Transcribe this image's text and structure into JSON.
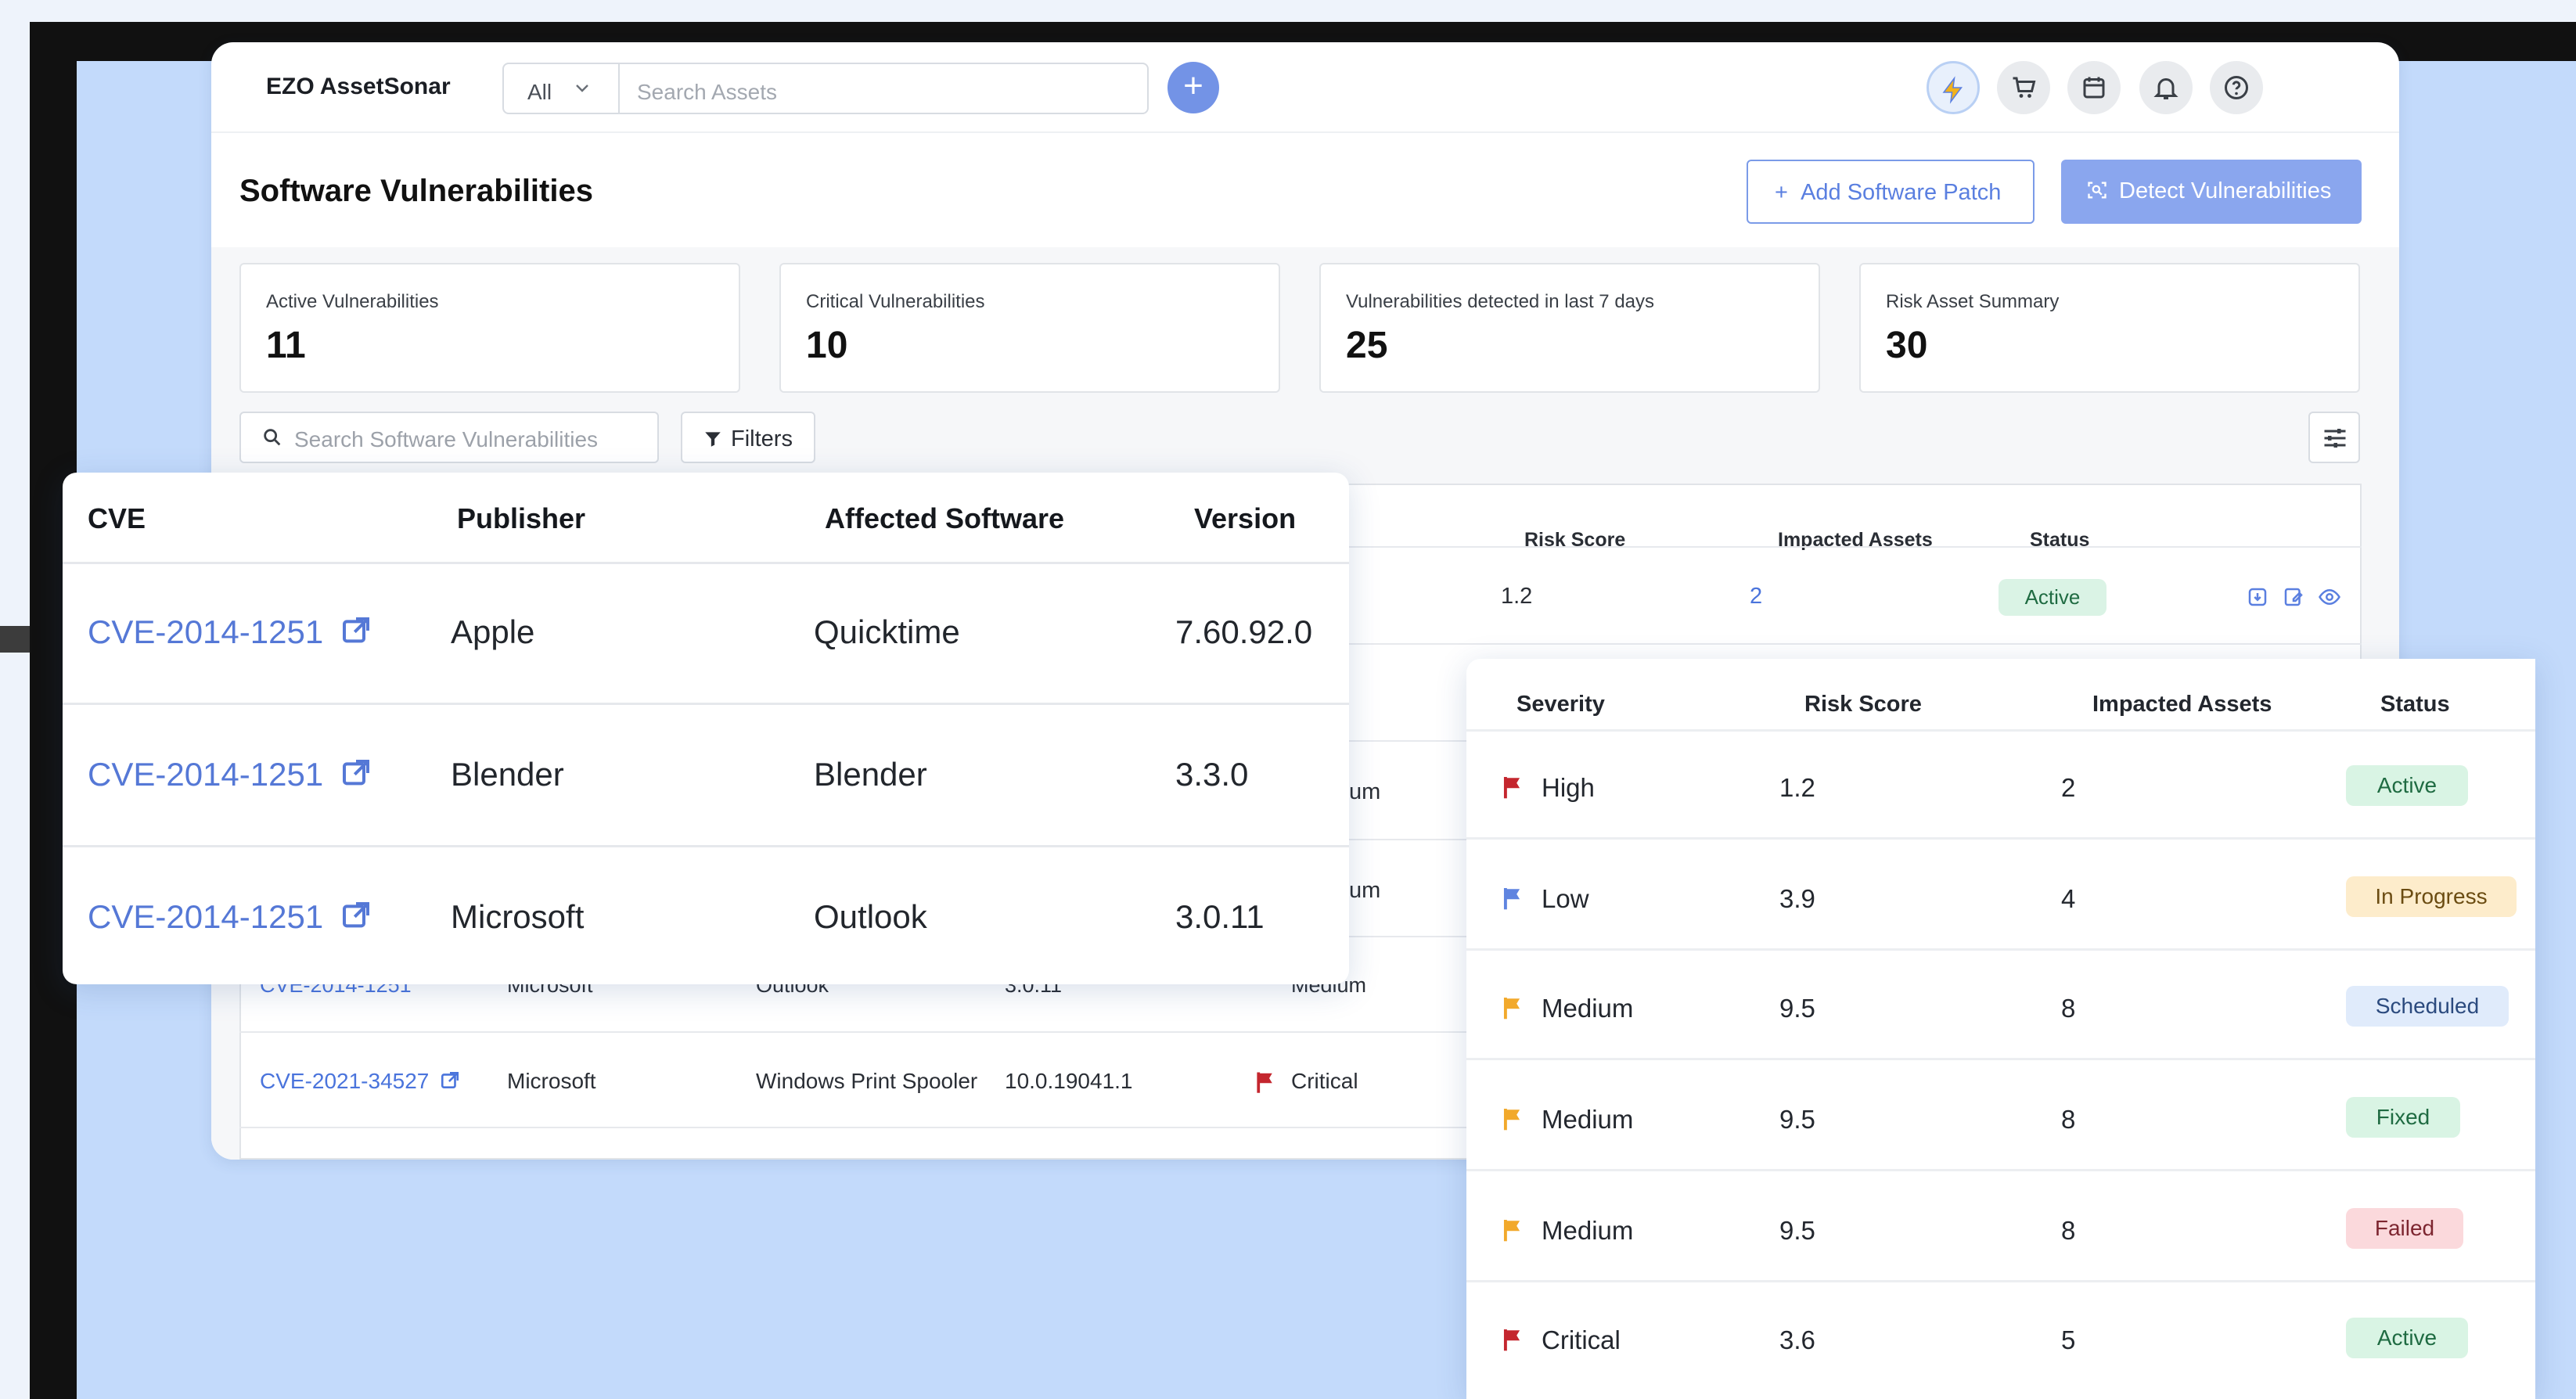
{
  "app": {
    "brand": "EZO AssetSonar"
  },
  "topbar": {
    "scope_value": "All",
    "search_placeholder": "Search Assets",
    "icons": [
      "add-icon",
      "bolt-icon",
      "cart-icon",
      "calendar-icon",
      "bell-icon",
      "help-icon"
    ]
  },
  "page": {
    "title": "Software Vulnerabilities",
    "add_patch_label": "Add Software Patch",
    "detect_label": "Detect Vulnerabilities"
  },
  "stats": [
    {
      "label": "Active Vulnerabilities",
      "value": "11"
    },
    {
      "label": "Critical Vulnerabilities",
      "value": "10"
    },
    {
      "label": "Vulnerabilities detected in last 7 days",
      "value": "25"
    },
    {
      "label": "Risk Asset Summary",
      "value": "30"
    }
  ],
  "toolbar": {
    "search_placeholder": "Search Software Vulnerabilities",
    "filters_label": "Filters"
  },
  "table": {
    "headers": {
      "risk_score": "Risk Score",
      "impacted_assets": "Impacted Assets",
      "status": "Status"
    },
    "row1": {
      "risk_score": "1.2",
      "impacted": "2",
      "status": "Active"
    },
    "row_partial_sev": [
      "um",
      "um",
      "Medium"
    ],
    "row_partial_cve": "CVE-2014-1251",
    "row_partial_publisher": "Microsoft",
    "row_partial_software": "Outlook",
    "row_partial_version": "3.0.11",
    "last_row": {
      "cve": "CVE-2021-34527",
      "publisher": "Microsoft",
      "software": "Windows Print Spooler",
      "version": "10.0.19041.1",
      "severity": "Critical"
    }
  },
  "card_left": {
    "headers": {
      "cve": "CVE",
      "publisher": "Publisher",
      "software": "Affected Software",
      "version": "Version"
    },
    "rows": [
      {
        "cve": "CVE-2014-1251",
        "publisher": "Apple",
        "software": "Quicktime",
        "version": "7.60.92.0"
      },
      {
        "cve": "CVE-2014-1251",
        "publisher": "Blender",
        "software": "Blender",
        "version": "3.3.0"
      },
      {
        "cve": "CVE-2014-1251",
        "publisher": "Microsoft",
        "software": "Outlook",
        "version": "3.0.11"
      }
    ]
  },
  "card_right": {
    "headers": {
      "severity": "Severity",
      "risk_score": "Risk Score",
      "impacted_assets": "Impacted Assets",
      "status": "Status"
    },
    "rows": [
      {
        "severity": "High",
        "risk_score": "1.2",
        "impacted": "2",
        "status": "Active"
      },
      {
        "severity": "Low",
        "risk_score": "3.9",
        "impacted": "4",
        "status": "In Progress"
      },
      {
        "severity": "Medium",
        "risk_score": "9.5",
        "impacted": "8",
        "status": "Scheduled"
      },
      {
        "severity": "Medium",
        "risk_score": "9.5",
        "impacted": "8",
        "status": "Fixed"
      },
      {
        "severity": "Medium",
        "risk_score": "9.5",
        "impacted": "8",
        "status": "Failed"
      },
      {
        "severity": "Critical",
        "risk_score": "3.6",
        "impacted": "5",
        "status": "Active"
      }
    ]
  },
  "colors": {
    "accent": "#5a7fe0",
    "flag_high": "#c4262e",
    "flag_low": "#5f84e0",
    "flag_medium": "#f2a92b",
    "background": "#c3dafb"
  }
}
